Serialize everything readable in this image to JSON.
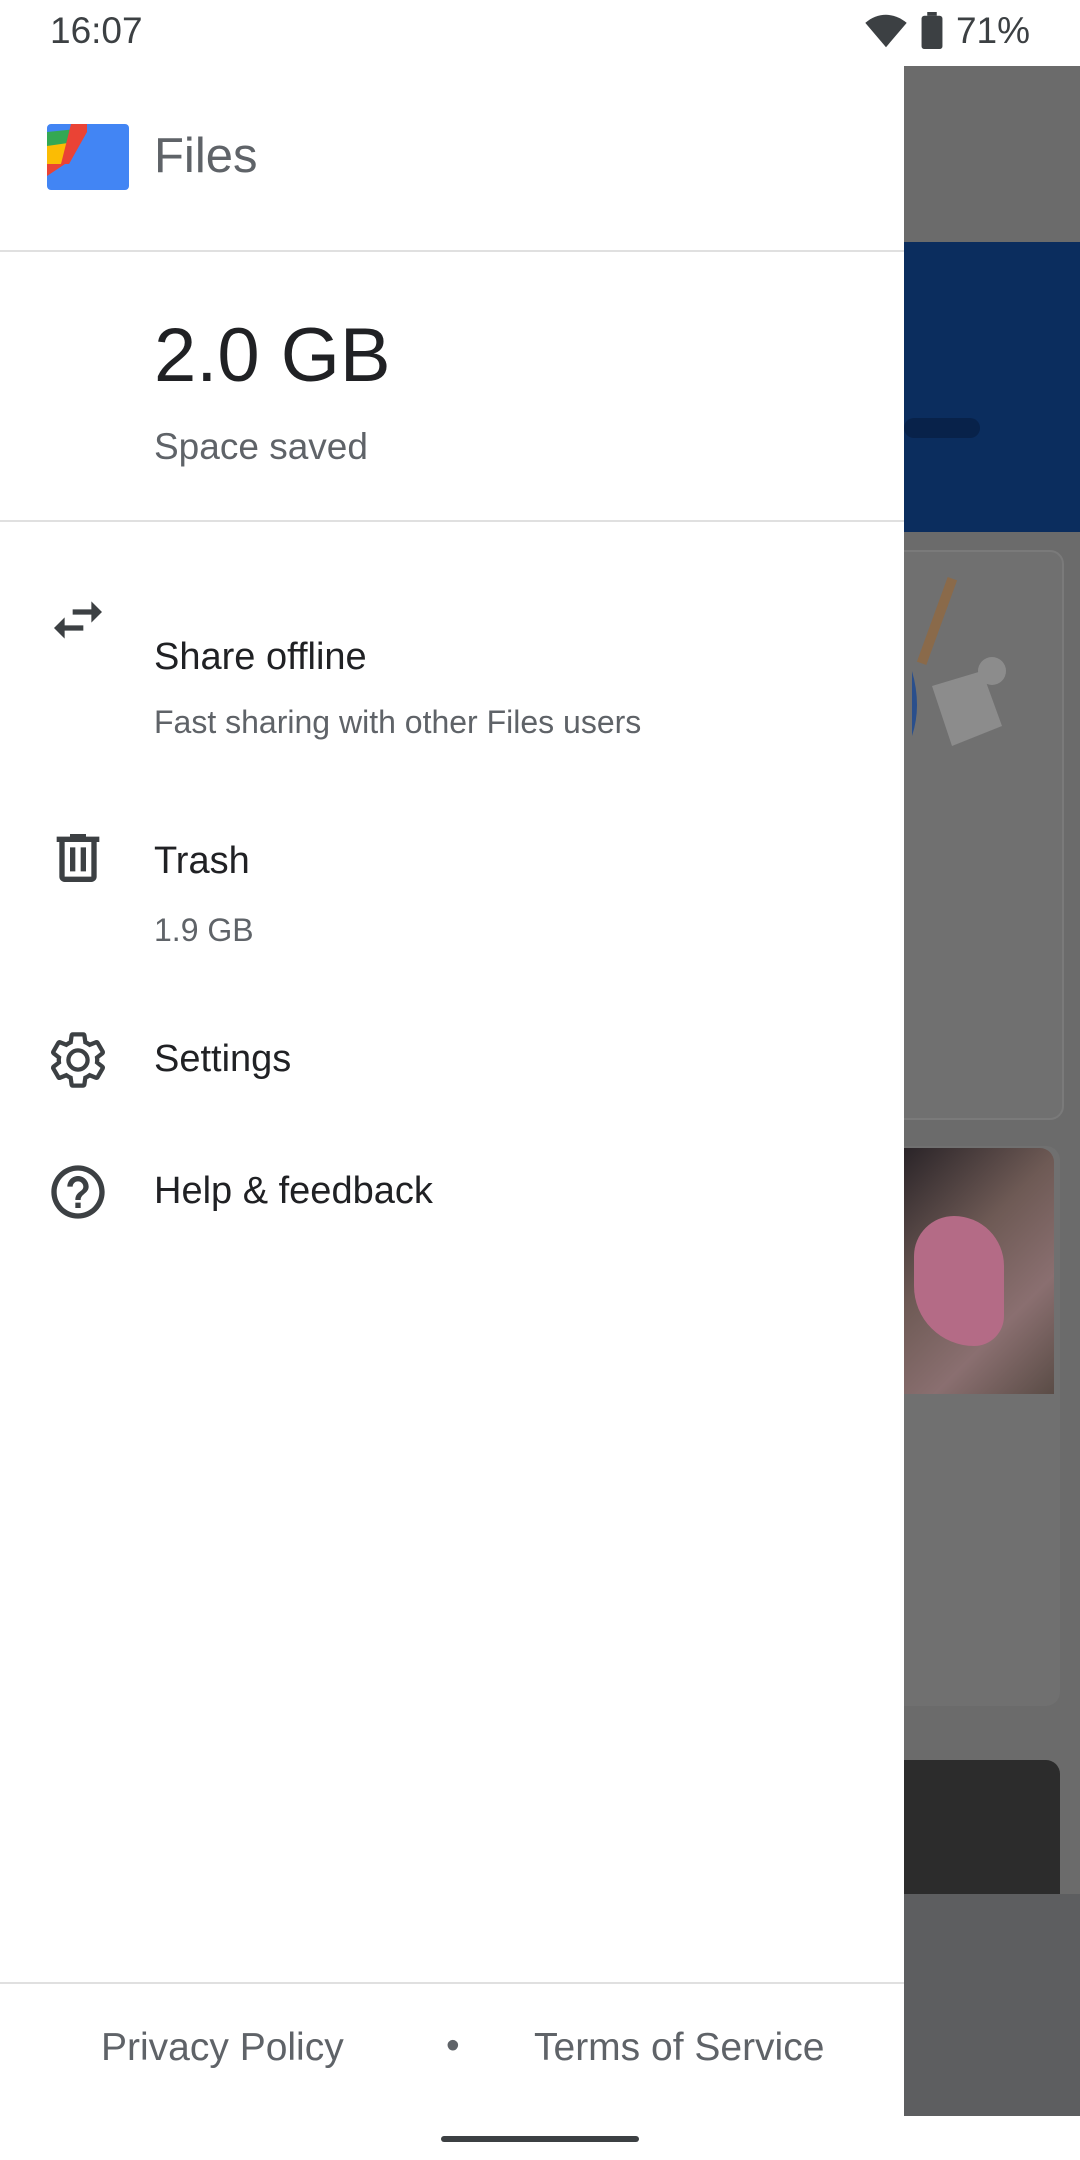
{
  "status_bar": {
    "time": "16:07",
    "battery": "71%",
    "icons": [
      "wifi-icon",
      "battery-icon"
    ]
  },
  "drawer": {
    "app_name": "Files",
    "storage": {
      "amount": "2.0 GB",
      "label": "Space saved"
    },
    "items": [
      {
        "title": "Share offline",
        "subtitle": "Fast sharing with other Files users",
        "icon": "swap-arrows-icon"
      },
      {
        "title": "Trash",
        "subtitle": "1.9 GB",
        "icon": "trash-icon"
      },
      {
        "title": "Settings",
        "icon": "gear-icon"
      },
      {
        "title": "Help & feedback",
        "icon": "help-icon"
      }
    ],
    "footer": {
      "privacy": "Privacy Policy",
      "separator": "•",
      "terms": "Terms of Service"
    }
  },
  "colors": {
    "text_primary": "#202124",
    "text_secondary": "#5f6368",
    "scrim": "#6b6b6b",
    "header_blue": "#0b2d5e"
  }
}
